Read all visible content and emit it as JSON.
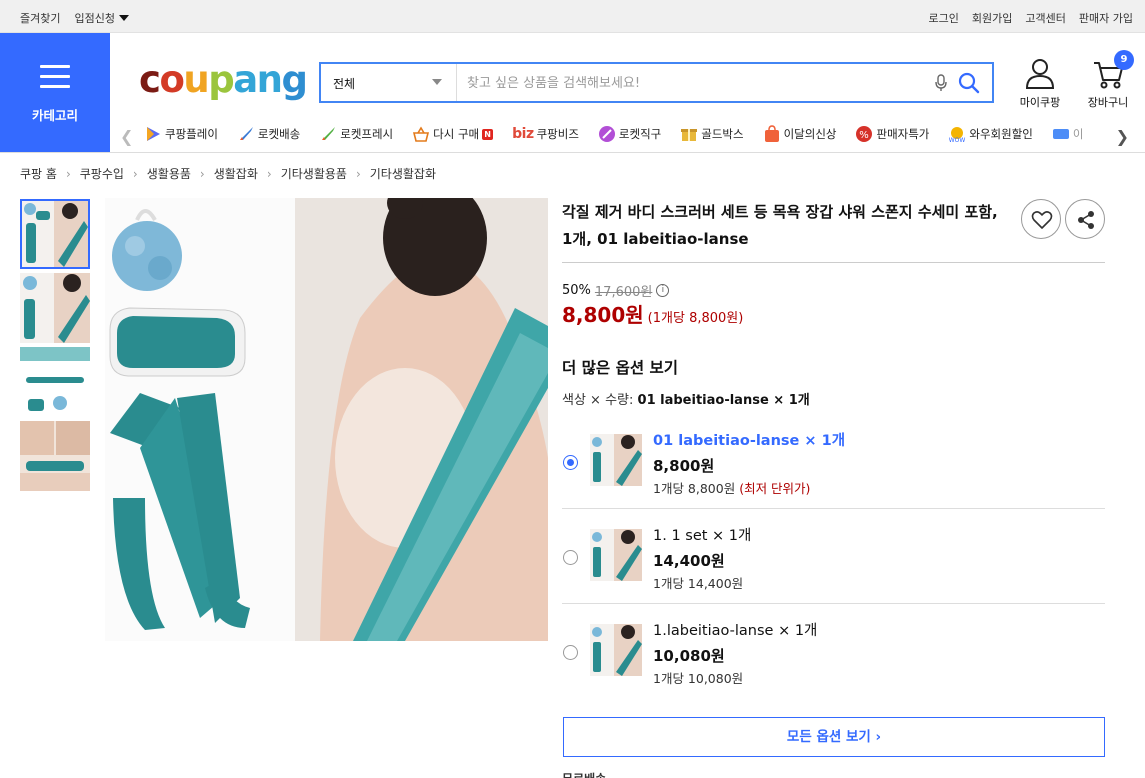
{
  "topbar": {
    "bookmark": "즐겨찾기",
    "store_apply": "입점신청",
    "links": [
      "로그인",
      "회원가입",
      "고객센터",
      "판매자 가입"
    ]
  },
  "category": {
    "label": "카테고리"
  },
  "logo": {
    "text": [
      "c",
      "o",
      "u",
      "p",
      "a",
      "n",
      "g"
    ]
  },
  "search": {
    "category_value": "전체",
    "placeholder": "찾고 싶은 상품을 검색해보세요!"
  },
  "header_icons": {
    "mypage_label": "마이쿠팡",
    "cart_label": "장바구니",
    "cart_count": "9"
  },
  "quicknav": {
    "items": [
      {
        "label": "쿠팡플레이",
        "icon": "coupang-play-icon"
      },
      {
        "label": "로켓배송",
        "icon": "rocket-icon"
      },
      {
        "label": "로켓프레시",
        "icon": "rocket-fresh-icon"
      },
      {
        "label": "다시 구매",
        "icon": "basket-icon",
        "badge": "N"
      },
      {
        "label": "쿠팡비즈",
        "icon": "biz-icon",
        "prefix": "biz"
      },
      {
        "label": "로켓직구",
        "icon": "rocket-global-icon"
      },
      {
        "label": "골드박스",
        "icon": "goldbox-icon"
      },
      {
        "label": "이달의신상",
        "icon": "new-bag-icon"
      },
      {
        "label": "판매자특가",
        "icon": "percent-icon"
      },
      {
        "label": "와우회원할인",
        "icon": "wow-icon"
      },
      {
        "label": "이",
        "icon": "coupon-icon"
      }
    ]
  },
  "breadcrumb": [
    "쿠팡 홈",
    "쿠팡수입",
    "생활용품",
    "생활잡화",
    "기타생활용품",
    "기타생활잡화"
  ],
  "product": {
    "title": "각질 제거 바디 스크러버 세트 등 목욕 장갑 샤워 스폰지 수세미 포함, 1개, 01 labeitiao-lanse",
    "discount_rate": "50%",
    "original_price": "17,600원",
    "info": "i",
    "sale_price": "8,800원",
    "unit_price": "(1개당 8,800원)",
    "more_options_title": "더 많은 옵션 보기",
    "selection_label": "색상 × 수량:",
    "selection_value": "01 labeitiao-lanse × 1개",
    "options": [
      {
        "name": "01 labeitiao-lanse × 1개",
        "price": "8,800원",
        "unit": "1개당 8,800원",
        "note": "(최저 단위가)",
        "selected": true
      },
      {
        "name": "1. 1 set × 1개",
        "price": "14,400원",
        "unit": "1개당 14,400원",
        "note": "",
        "selected": false
      },
      {
        "name": "1.labeitiao-lanse × 1개",
        "price": "10,080원",
        "unit": "1개당 10,080원",
        "note": "",
        "selected": false
      }
    ],
    "all_options_button": "모든 옵션 보기 ›",
    "cutoff_text": "무료배송"
  },
  "colors": {
    "accent": "#346aff",
    "price_red": "#ae0000",
    "product_teal": "#2a8c8f",
    "topbar_bg": "#f0f0f0"
  }
}
